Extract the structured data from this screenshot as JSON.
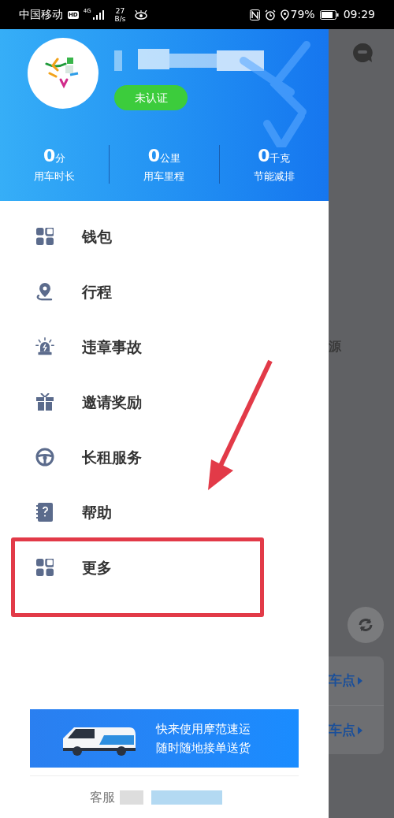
{
  "status_bar": {
    "carrier": "中国移动",
    "hd": "HD",
    "network": "4G",
    "speed_value": "27",
    "speed_unit": "B/s",
    "battery": "79%",
    "time": "09:29"
  },
  "profile": {
    "badge": "未认证",
    "stats": [
      {
        "value": "0",
        "unit": "分",
        "label": "用车时长"
      },
      {
        "value": "0",
        "unit": "公里",
        "label": "用车里程"
      },
      {
        "value": "0",
        "unit": "千克",
        "label": "节能减排"
      }
    ]
  },
  "menu": [
    {
      "kind": "grid",
      "label": "钱包",
      "highlighted": false
    },
    {
      "kind": "pin",
      "label": "行程",
      "highlighted": false
    },
    {
      "kind": "alarm",
      "label": "违章事故",
      "highlighted": false
    },
    {
      "kind": "gift",
      "label": "邀请奖励",
      "highlighted": false
    },
    {
      "kind": "wheel",
      "label": "长租服务",
      "highlighted": false
    },
    {
      "kind": "help",
      "label": "帮助",
      "highlighted": false
    },
    {
      "kind": "grid",
      "label": "更多",
      "highlighted": true
    }
  ],
  "banner": {
    "lines": [
      "快来使用摩范速运",
      "随时随地接单送货"
    ]
  },
  "footer": {
    "label": "客服"
  },
  "map": {
    "place": "源",
    "cards": [
      "车点",
      "车点"
    ]
  }
}
